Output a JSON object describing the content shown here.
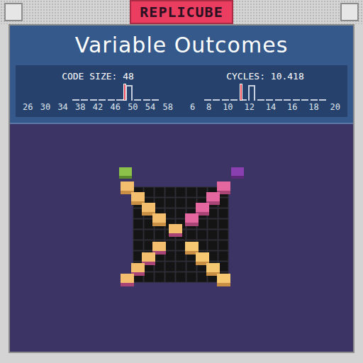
{
  "window": {
    "title": "REPLICUBE"
  },
  "puzzle": {
    "title": "Variable Outcomes"
  },
  "stats": [
    {
      "label": "CODE SIZE: 48",
      "level": 0.69,
      "ticks": [
        "26",
        "30",
        "34",
        "38",
        "42",
        "46",
        "50",
        "54",
        "58"
      ],
      "bars": [
        0,
        0,
        0,
        0,
        0,
        0.06,
        0.06,
        0.06,
        0.06,
        0.06,
        0.06,
        1,
        0.06,
        0.06,
        0.06,
        0
      ]
    },
    {
      "label": "CYCLES: 10.418",
      "level": 0.33,
      "ticks": [
        "6",
        "8",
        "10",
        "12",
        "14",
        "16",
        "18",
        "20"
      ],
      "bars": [
        0,
        0.06,
        0.06,
        0.06,
        0.06,
        0.06,
        1,
        0.06,
        0.06,
        0.06,
        0.06,
        0.06,
        0.06,
        0.06,
        0.06,
        0
      ]
    }
  ]
}
